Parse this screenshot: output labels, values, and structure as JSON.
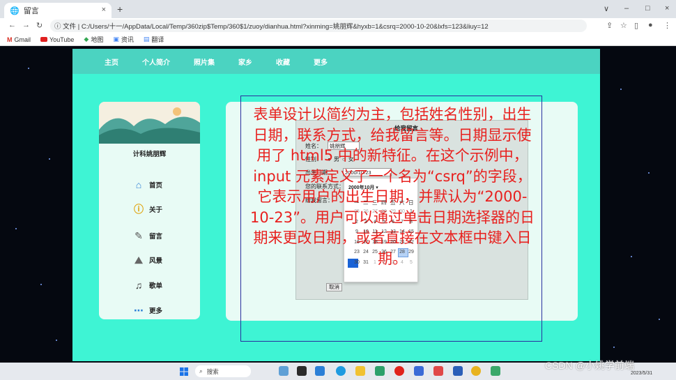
{
  "browser": {
    "tab_title": "留言",
    "tab_close": "×",
    "new_tab": "+",
    "window_controls": [
      "∨",
      "–",
      "□",
      "×"
    ],
    "url_prefix": "ⓘ 文件 |",
    "url": "C:/Users/十一/AppData/Local/Temp/360zip$Temp/360$1/zuoy/dianhua.html?xinming=姚朋辉&hyxb=1&csrq=2000-10-20&lxfs=123&liuy=12",
    "bookmarks": [
      "Gmail",
      "YouTube",
      "地图",
      "资讯",
      "翻译"
    ]
  },
  "nav": {
    "items": [
      "主页",
      "个人简介",
      "照片集",
      "家乡",
      "收藏",
      "更多"
    ]
  },
  "sidebar": {
    "name": "计科姚朋辉",
    "items": [
      {
        "label": "首页",
        "icon": "home-icon"
      },
      {
        "label": "关于",
        "icon": "info-icon"
      },
      {
        "label": "留言",
        "icon": "edit-icon"
      },
      {
        "label": "风景",
        "icon": "landscape-icon"
      },
      {
        "label": "歌单",
        "icon": "music-icon"
      },
      {
        "label": "更多",
        "icon": "more-icon"
      }
    ]
  },
  "form": {
    "title": "给我留言",
    "name_label": "姓名：",
    "name_value": "姚朋辉",
    "gender_label": "性别：",
    "gender_options": [
      "男",
      "女"
    ],
    "date_label": "出生日期：",
    "date_value": "2000/10/23",
    "contact_label": "您的联系方式：",
    "message_label": "给我留言：",
    "cancel_label": "取消"
  },
  "calendar": {
    "header": "2000年10月 ▾",
    "weekdays": [
      "一",
      "二",
      "三",
      "四",
      "五",
      "六",
      "日"
    ],
    "rows": [
      [
        "25",
        "26",
        "27",
        "28",
        "29",
        "30",
        "1"
      ],
      [
        "2",
        "3",
        "4",
        "5",
        "6",
        "7",
        "8"
      ],
      [
        "9",
        "10",
        "11",
        "12",
        "13",
        "14",
        "15"
      ],
      [
        "16",
        "17",
        "18",
        "19",
        "20",
        "21",
        "22"
      ],
      [
        "23",
        "24",
        "25",
        "26",
        "27",
        "28",
        "29"
      ],
      [
        "30",
        "31",
        "1",
        "2",
        "3",
        "4",
        "5"
      ]
    ]
  },
  "annotation": {
    "text": "表单设计以简约为主，包括姓名性别，出生日期，联系方式，给我留言等。日期显示使用了 html5 中的新特征。在这个示例中，input 元素定义了一个名为“csrq”的字段，它表示用户的出生日期，并默认为“2000-10-23”。用户可以通过单击日期选择器的日期来更改日期，或者直接在文本框中键入日期。"
  },
  "taskbar": {
    "search_label": "搜索",
    "clock": "2023/5/31"
  },
  "watermark": "CSDN @小姚学前端"
}
